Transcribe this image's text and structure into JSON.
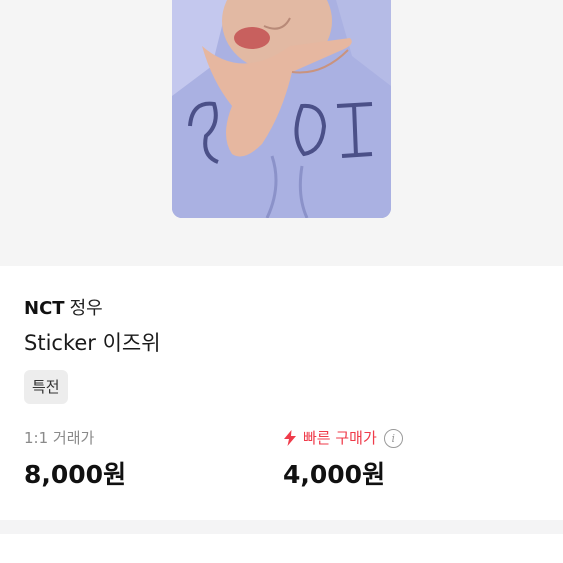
{
  "product": {
    "group": "NCT",
    "member": "정우",
    "title": "Sticker 이즈위",
    "tag": "특전"
  },
  "prices": {
    "one_to_one_label": "1:1 거래가",
    "one_to_one_value": "8,000원",
    "fast_buy_label": "빠른 구매가",
    "fast_buy_value": "4,000원",
    "fast_buy_icon": "lightning-icon",
    "info_icon": "info-icon"
  },
  "colors": {
    "accent_red": "#ef3b4a",
    "photo_bg": "#a9b0e0"
  }
}
